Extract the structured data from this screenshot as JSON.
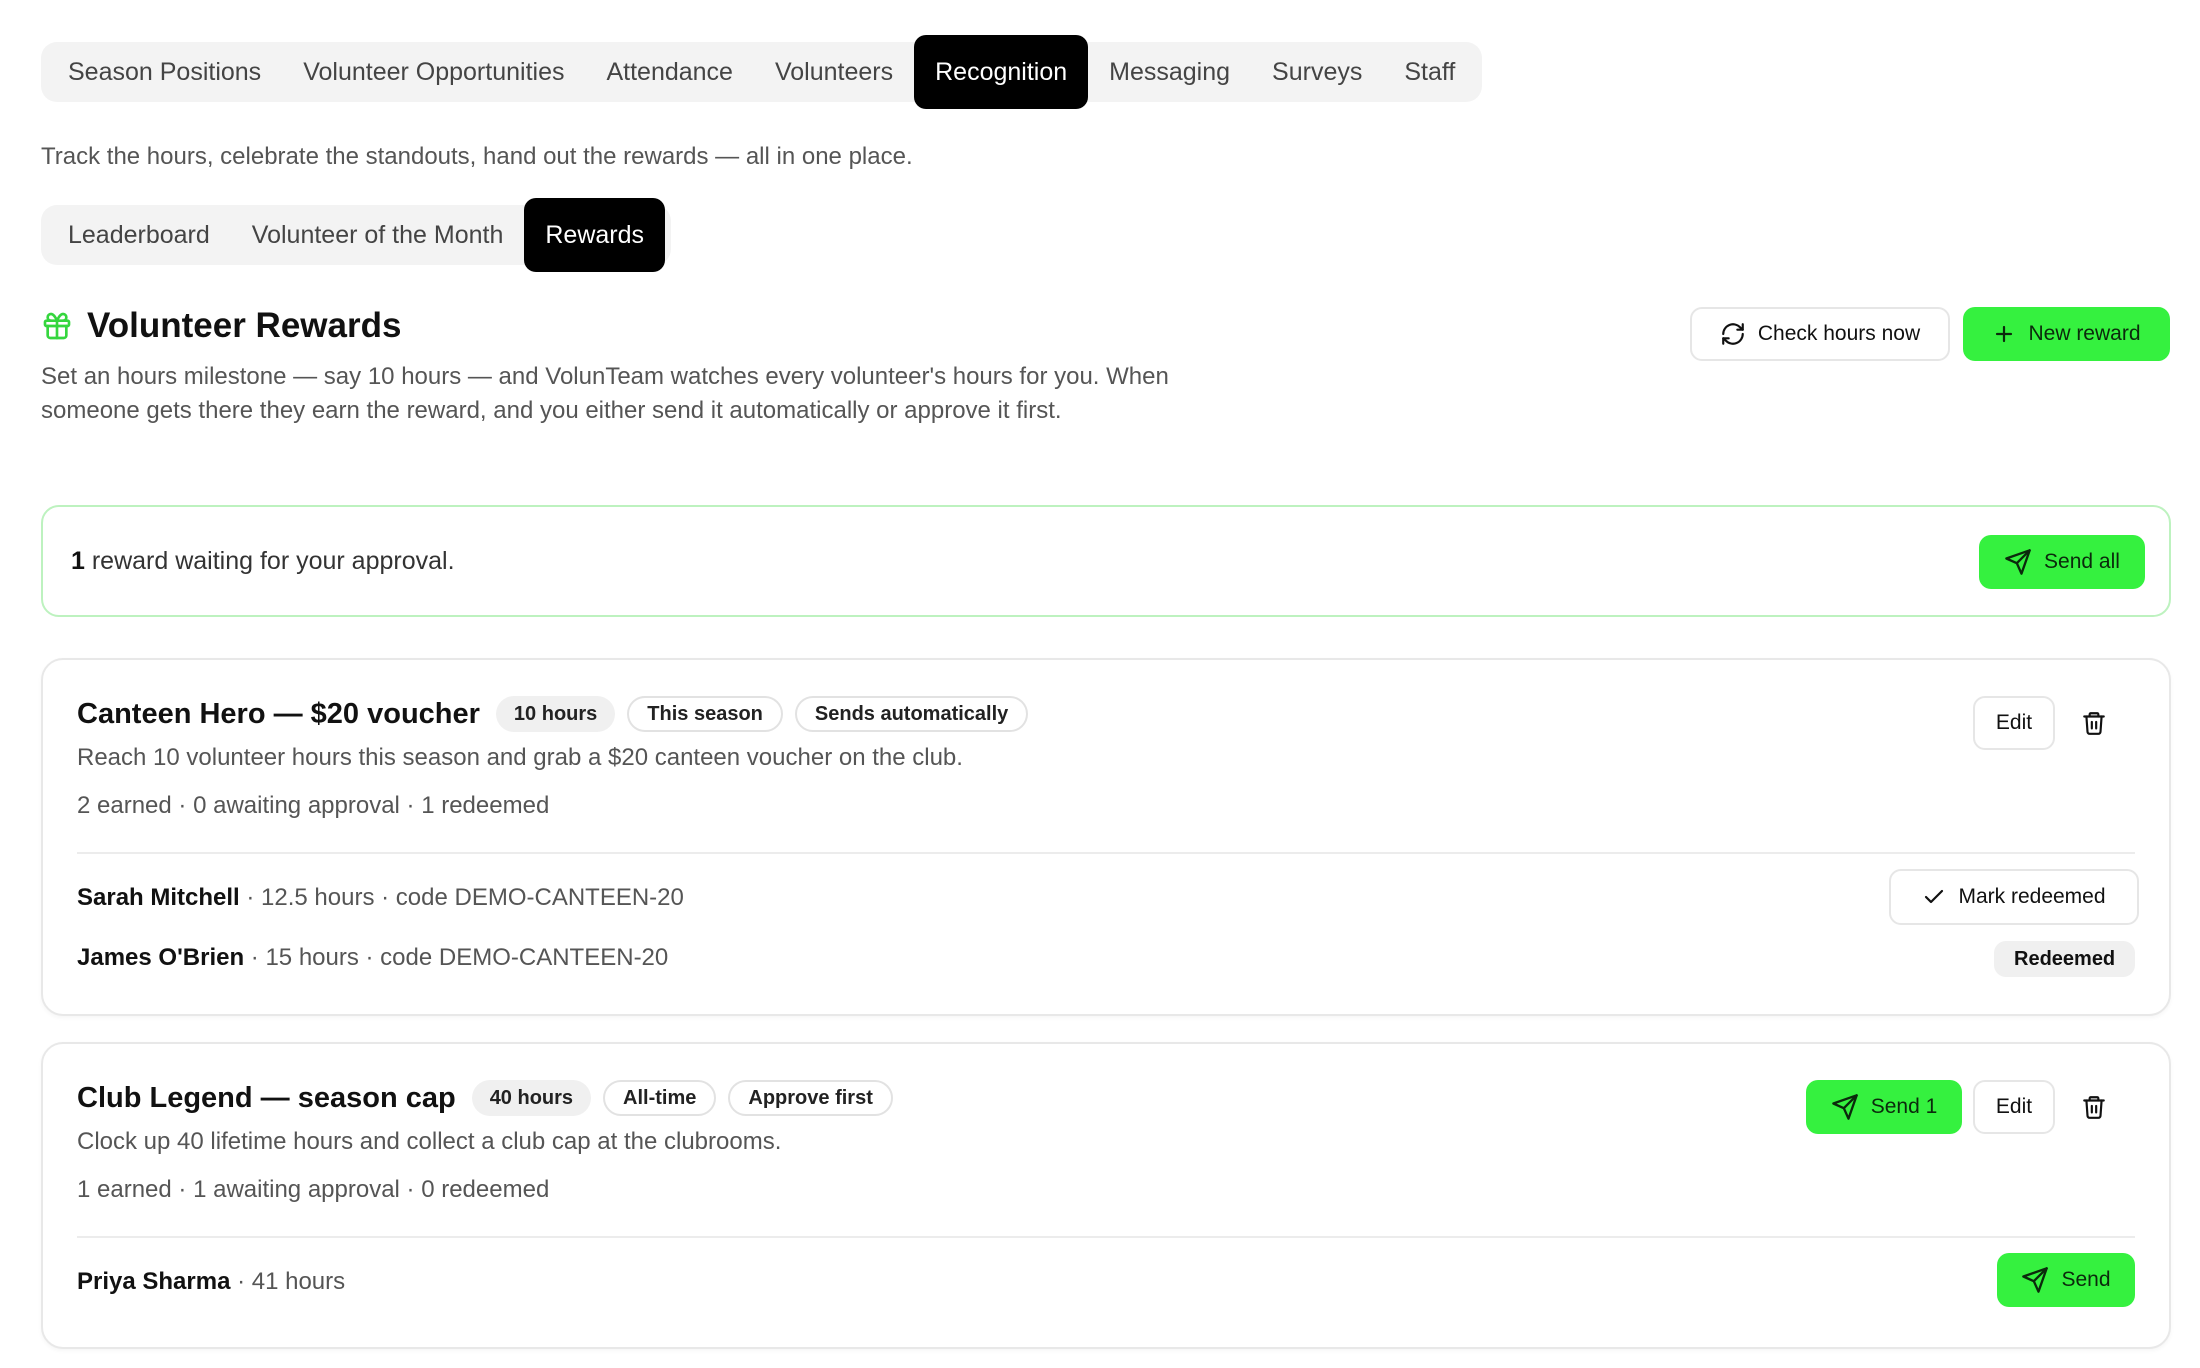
{
  "top_tabs": [
    {
      "label": "Season Positions"
    },
    {
      "label": "Volunteer Opportunities"
    },
    {
      "label": "Attendance"
    },
    {
      "label": "Volunteers"
    },
    {
      "label": "Recognition",
      "active": true
    },
    {
      "label": "Messaging"
    },
    {
      "label": "Surveys"
    },
    {
      "label": "Staff"
    }
  ],
  "intro": "Track the hours, celebrate the standouts, hand out the rewards — all in one place.",
  "sub_tabs": [
    {
      "label": "Leaderboard"
    },
    {
      "label": "Volunteer of the Month"
    },
    {
      "label": "Rewards",
      "active": true
    }
  ],
  "section": {
    "icon": "gift-icon",
    "title": "Volunteer Rewards",
    "description": "Set an hours milestone — say 10 hours — and VolunTeam watches every volunteer's hours for you. When someone gets there they earn the reward, and you either send it automatically or approve it first.",
    "check_hours_label": "Check hours now",
    "new_reward_label": "New reward"
  },
  "approval_banner": {
    "count": "1",
    "text": " reward waiting for your approval.",
    "send_all_label": "Send all"
  },
  "rewards": [
    {
      "title": "Canteen Hero — $20 voucher",
      "chips": [
        "10 hours",
        "This season",
        "Sends automatically"
      ],
      "description": "Reach 10 volunteer hours this season and grab a $20 canteen voucher on the club.",
      "stats": "2 earned · 0 awaiting approval · 1 redeemed",
      "edit_label": "Edit",
      "entries": [
        {
          "name": "Sarah Mitchell",
          "detail": " · 12.5 hours · code DEMO-CANTEEN-20",
          "action_label": "Mark redeemed"
        },
        {
          "name": "James O'Brien",
          "detail": " · 15 hours · code DEMO-CANTEEN-20",
          "status_label": "Redeemed"
        }
      ]
    },
    {
      "title": "Club Legend — season cap",
      "chips": [
        "40 hours",
        "All-time",
        "Approve first"
      ],
      "description": "Clock up 40 lifetime hours and collect a club cap at the clubrooms.",
      "stats": "1 earned · 1 awaiting approval · 0 redeemed",
      "send_label": "Send 1",
      "edit_label": "Edit",
      "entries": [
        {
          "name": "Priya Sharma",
          "detail": " · 41 hours",
          "action_label": "Send"
        }
      ]
    }
  ],
  "colors": {
    "accent_green": "#35f13f",
    "active_tab": "#000000",
    "banner_border": "#bdf2bf"
  }
}
